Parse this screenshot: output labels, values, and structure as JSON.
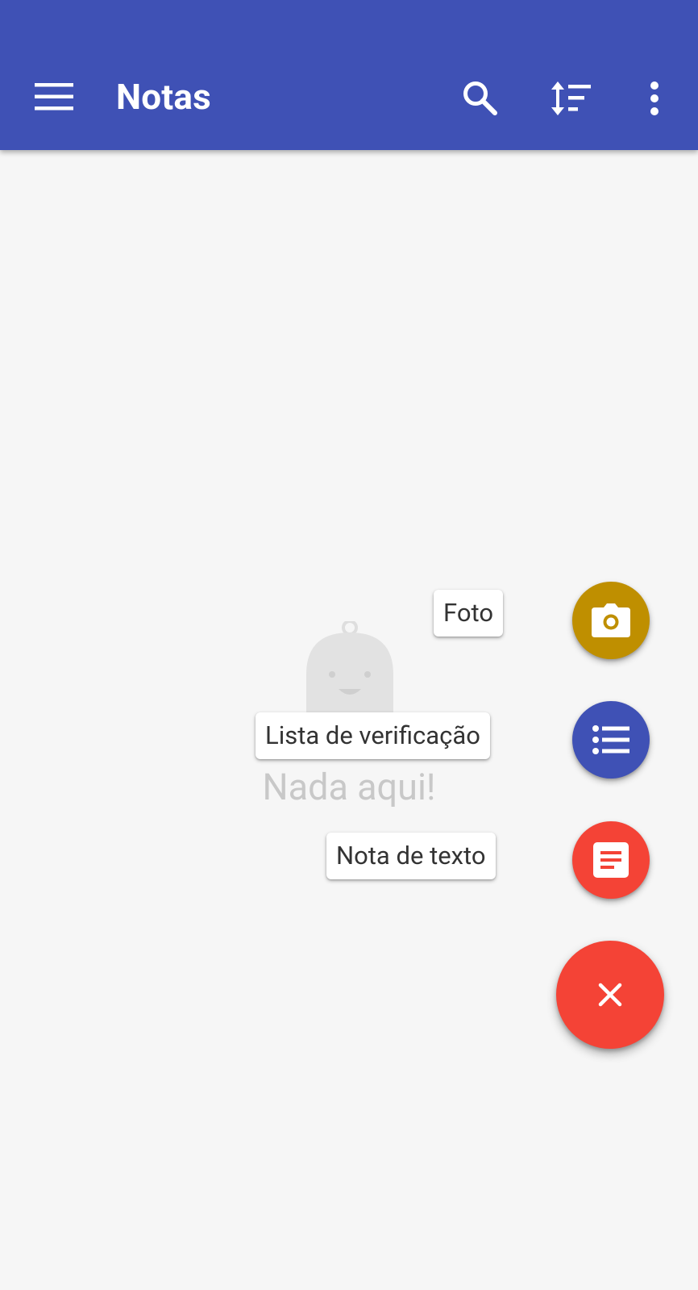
{
  "appbar": {
    "title": "Notas",
    "menu_icon": "hamburger-menu-icon",
    "search_icon": "search-icon",
    "sort_icon": "sort-icon",
    "more_icon": "more-vertical-icon",
    "background_color": "#3f51b5"
  },
  "empty_state": {
    "message": "Nada aqui!",
    "illustration": "bell-character-illustration"
  },
  "fab_menu": {
    "items": [
      {
        "label": "Foto",
        "icon": "camera-icon",
        "color": "#bf8f00"
      },
      {
        "label": "Lista de verificação",
        "icon": "checklist-icon",
        "color": "#3f51b5"
      },
      {
        "label": "Nota de texto",
        "icon": "text-note-icon",
        "color": "#f44336"
      }
    ],
    "main": {
      "icon": "close-icon",
      "color": "#f44336"
    }
  }
}
